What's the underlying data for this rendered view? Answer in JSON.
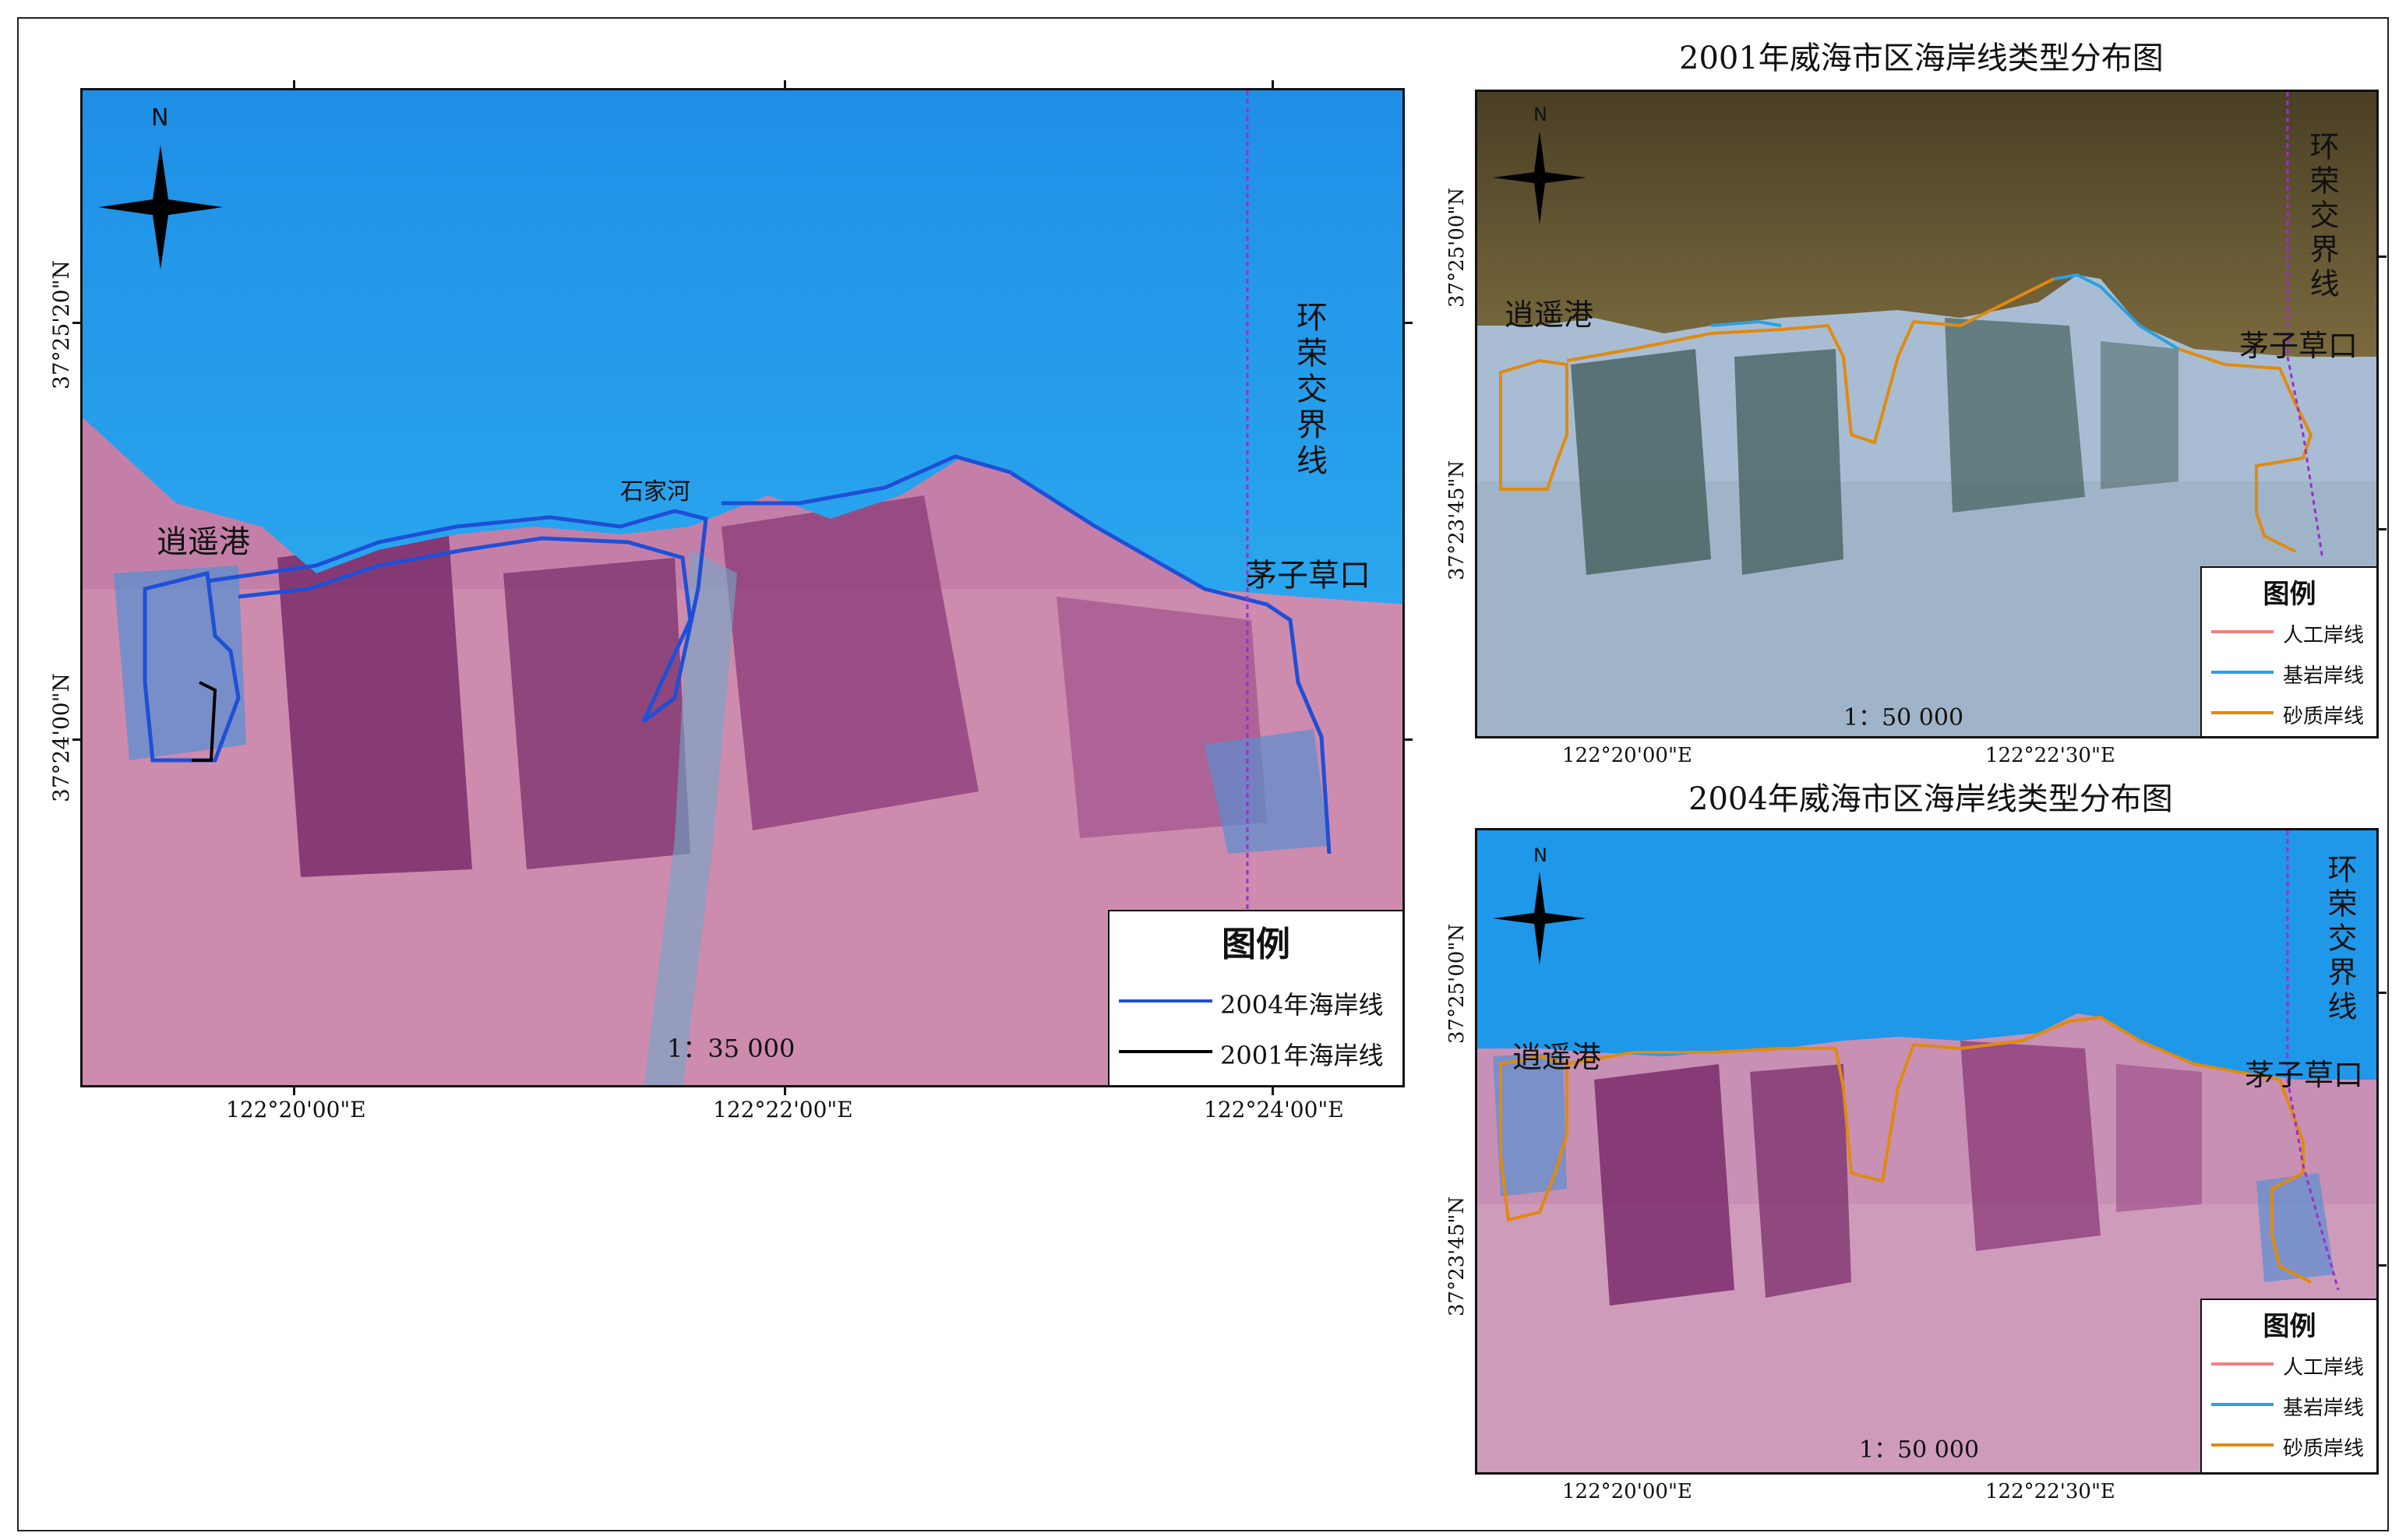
{
  "main_map": {
    "labels": {
      "port": "逍遥港",
      "river": "石家河",
      "border": "环荣交界线",
      "mouth": "茅子草口"
    },
    "scale": "1：35 000",
    "x_ticks": [
      "122°20'00\"E",
      "122°22'00\"E",
      "122°24'00\"E"
    ],
    "y_ticks": [
      "37°25'20\"N",
      "37°24'00\"N"
    ],
    "legend": {
      "title": "图例",
      "items": [
        {
          "label": "2004年海岸线",
          "color": "#1f4fd6"
        },
        {
          "label": "2001年海岸线",
          "color": "#000000"
        }
      ]
    },
    "north": "N"
  },
  "map_2001": {
    "title": "2001年威海市区海岸线类型分布图",
    "labels": {
      "port": "逍遥港",
      "border": "环荣交界线",
      "mouth": "茅子草口"
    },
    "scale": "1：50 000",
    "x_ticks": [
      "122°20'00\"E",
      "122°22'30\"E"
    ],
    "y_ticks": [
      "37°25'00\"N",
      "37°23'45\"N"
    ],
    "legend": {
      "title": "图例",
      "items": [
        {
          "label": "人工岸线",
          "color": "#f08080"
        },
        {
          "label": "基岩岸线",
          "color": "#2aa0e0"
        },
        {
          "label": "砂质岸线",
          "color": "#e08a10"
        }
      ]
    },
    "north": "N"
  },
  "map_2004": {
    "title": "2004年威海市区海岸线类型分布图",
    "labels": {
      "port": "逍遥港",
      "border": "环荣交界线",
      "mouth": "茅子草口"
    },
    "scale": "1：50 000",
    "x_ticks": [
      "122°20'00\"E",
      "122°22'30\"E"
    ],
    "y_ticks": [
      "37°25'00\"N",
      "37°23'45\"N"
    ],
    "legend": {
      "title": "图例",
      "items": [
        {
          "label": "人工岸线",
          "color": "#f08080"
        },
        {
          "label": "基岩岸线",
          "color": "#2aa0e0"
        },
        {
          "label": "砂质岸线",
          "color": "#e08a10"
        }
      ]
    },
    "north": "N"
  }
}
